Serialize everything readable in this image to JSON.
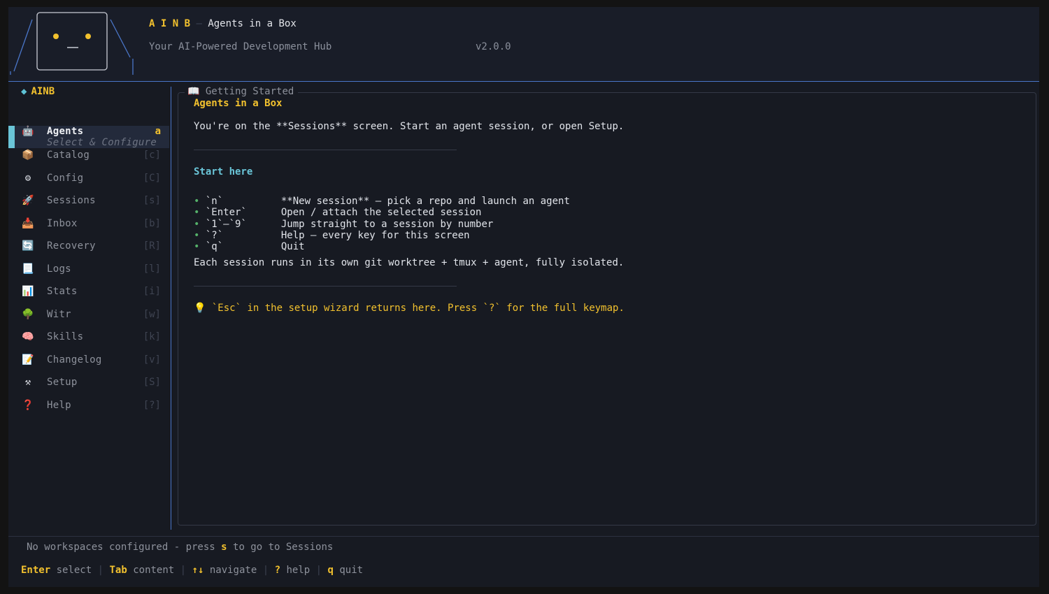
{
  "header": {
    "brand_letters": "A I N B",
    "brand_dash": " — ",
    "brand_name": "Agents in a Box",
    "tagline": "Your AI-Powered Development Hub",
    "version": "v2.0.0",
    "logo_face": "•_•"
  },
  "sidebar": {
    "title_icon": "◆",
    "title": "AINB",
    "items": [
      {
        "icon": "🤖",
        "label": "Agents",
        "sub": "Select & Configure",
        "key": "a",
        "active": true
      },
      {
        "icon": "📦",
        "label": "Catalog",
        "key": "[c]"
      },
      {
        "icon": "⚙",
        "label": "Config",
        "key": "[C]"
      },
      {
        "icon": "🚀",
        "label": "Sessions",
        "key": "[s]"
      },
      {
        "icon": "📥",
        "label": "Inbox",
        "key": "[b]"
      },
      {
        "icon": "🔄",
        "label": "Recovery",
        "key": "[R]"
      },
      {
        "icon": "📃",
        "label": "Logs",
        "key": "[l]"
      },
      {
        "icon": "📊",
        "label": "Stats",
        "key": "[i]"
      },
      {
        "icon": "🌳",
        "label": "Witr",
        "key": "[w]"
      },
      {
        "icon": "🧠",
        "label": "Skills",
        "key": "[k]"
      },
      {
        "icon": "📝",
        "label": "Changelog",
        "key": "[v]"
      },
      {
        "icon": "⚒",
        "label": "Setup",
        "key": "[S]"
      },
      {
        "icon": "❓",
        "label": "Help",
        "key": "[?]"
      }
    ]
  },
  "panel": {
    "title_icon": "📖",
    "title": "Getting Started",
    "heading": "Agents in a Box",
    "intro": "You're on the **Sessions** screen. Start an agent session, or open Setup.",
    "section_title": "Start here",
    "bullet_glyph": "•",
    "shortcuts": [
      {
        "key": "`n`",
        "desc": "**New session** — pick a repo and launch an agent"
      },
      {
        "key": "`Enter`",
        "desc": "Open / attach the selected session"
      },
      {
        "key": "`1`–`9`",
        "desc": "Jump straight to a session by number"
      },
      {
        "key": "`?`",
        "desc": "Help — every key for this screen"
      },
      {
        "key": "`q`",
        "desc": "Quit"
      }
    ],
    "isolation_note": "Each session runs in its own git worktree + tmux + agent, fully isolated.",
    "tip_icon": "💡",
    "tip": "`Esc` in the setup wizard returns here. Press `?` for the full keymap."
  },
  "footer": {
    "status_prefix": "No workspaces configured - press ",
    "status_key": "s",
    "status_suffix": " to go to Sessions",
    "hints": [
      {
        "key": "Enter",
        "label": "select"
      },
      {
        "key": "Tab",
        "label": "content"
      },
      {
        "key": "↑↓",
        "label": "navigate"
      },
      {
        "key": "?",
        "label": "help"
      },
      {
        "key": "q",
        "label": "quit"
      }
    ],
    "separator": "|"
  },
  "colors": {
    "accent_yellow": "#f2c12e",
    "accent_cyan": "#6ac5d8",
    "bullet_green": "#55b26a",
    "border_blue": "#4a76c8"
  }
}
